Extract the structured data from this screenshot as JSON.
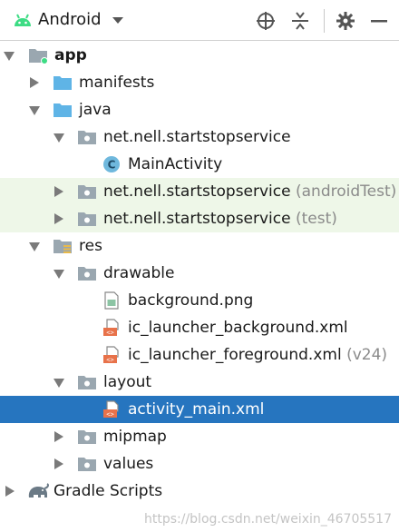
{
  "toolbar": {
    "title": "Android",
    "icons": [
      "android-icon",
      "dropdown-icon",
      "locate-icon",
      "collapse-all-icon",
      "settings-icon",
      "minimize-icon"
    ]
  },
  "tree": {
    "app": "app",
    "manifests": "manifests",
    "java": "java",
    "pkg_main": "net.nell.startstopservice",
    "main_activity": "MainActivity",
    "pkg_android_test": "net.nell.startstopservice",
    "pkg_android_test_suffix": "(androidTest)",
    "pkg_test": "net.nell.startstopservice",
    "pkg_test_suffix": "(test)",
    "res": "res",
    "drawable": "drawable",
    "background_png": "background.png",
    "ic_launcher_background": "ic_launcher_background.xml",
    "ic_launcher_foreground": "ic_launcher_foreground.xml",
    "ic_launcher_foreground_suffix": "(v24)",
    "layout": "layout",
    "activity_main": "activity_main.xml",
    "mipmap": "mipmap",
    "values": "values",
    "gradle_scripts": "Gradle Scripts"
  },
  "watermark": "https://blog.csdn.net/weixin_46705517",
  "colors": {
    "selection": "#2675bf",
    "alt_row": "#eef7e8",
    "folder_blue": "#5fb4e6",
    "folder_gray": "#9aa7b0",
    "android_green": "#3ddc84",
    "xml_orange": "#e8724a"
  }
}
